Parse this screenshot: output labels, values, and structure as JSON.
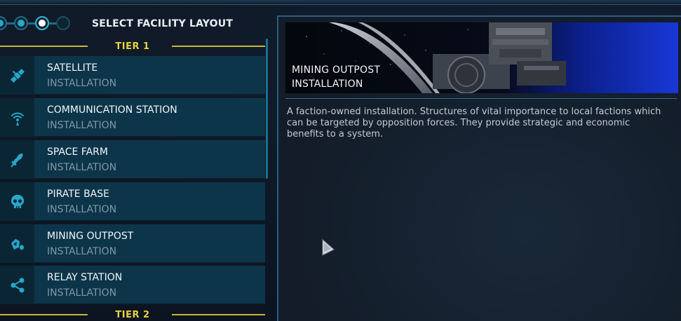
{
  "header": {
    "title": "SELECT FACILITY LAYOUT",
    "steps": [
      "done",
      "done",
      "current",
      "todo"
    ]
  },
  "tiers": [
    {
      "label": "TIER 1"
    },
    {
      "label": "TIER 2"
    }
  ],
  "facilities": [
    {
      "name": "SATELLITE",
      "kind": "INSTALLATION",
      "icon": "satellite-icon"
    },
    {
      "name": "COMMUNICATION STATION",
      "kind": "INSTALLATION",
      "icon": "antenna-icon"
    },
    {
      "name": "SPACE FARM",
      "kind": "INSTALLATION",
      "icon": "leaf-icon"
    },
    {
      "name": "PIRATE BASE",
      "kind": "INSTALLATION",
      "icon": "skull-icon"
    },
    {
      "name": "MINING OUTPOST",
      "kind": "INSTALLATION",
      "icon": "ore-icon"
    },
    {
      "name": "RELAY STATION",
      "kind": "INSTALLATION",
      "icon": "network-icon"
    }
  ],
  "detail": {
    "title_line1": "MINING OUTPOST",
    "title_line2": "INSTALLATION",
    "description": "A faction-owned installation. Structures of vital importance to local factions which can be targeted by opposition forces. They provide strategic and economic benefits to a system."
  },
  "colors": {
    "accent": "#2aa7c5",
    "tier_gold": "#e8cf3f",
    "item_bg": "#0d3549",
    "panel_border": "#2a5e80"
  }
}
